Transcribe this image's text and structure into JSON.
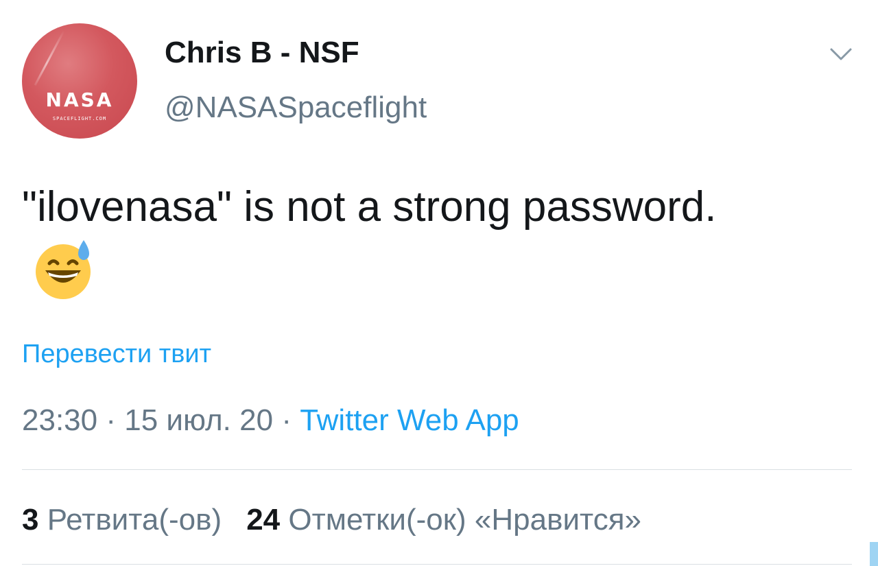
{
  "user": {
    "display_name": "Chris B - NSF",
    "handle": "@NASASpaceflight",
    "avatar_logo_text": "NASA",
    "avatar_sub_text": "SPACEFLIGHT.COM"
  },
  "tweet": {
    "text": "\"ilovenasa\" is not a strong password.",
    "emoji": "grinning-face-with-sweat-icon",
    "translate_label": "Перевести твит"
  },
  "meta": {
    "time": "23:30",
    "separator": "·",
    "date": "15 июл. 20",
    "source": "Twitter Web App"
  },
  "stats": {
    "retweets_count": "3",
    "retweets_label": "Ретвита(-ов)",
    "likes_count": "24",
    "likes_label": "Отметки(-ок) «Нравится»"
  },
  "colors": {
    "accent": "#1da1f2",
    "secondary_text": "#657786",
    "primary_text": "#14171a",
    "avatar_bg": "#d3585e",
    "divider": "#d9dfe3"
  }
}
